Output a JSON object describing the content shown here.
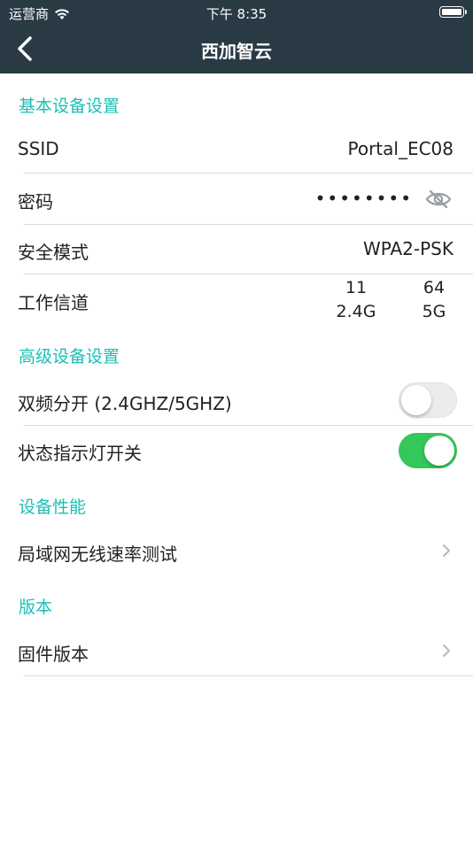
{
  "status_bar": {
    "carrier": "运营商",
    "time": "下午 8:35"
  },
  "nav": {
    "title": "西加智云"
  },
  "sections": {
    "basic": {
      "header": "基本设备设置",
      "ssid_label": "SSID",
      "ssid_value": "Portal_EC08",
      "password_label": "密码",
      "password_mask": "••••••••",
      "security_label": "安全模式",
      "security_value": "WPA2-PSK",
      "channel_label": "工作信道",
      "channel_24_num": "11",
      "channel_24_band": "2.4G",
      "channel_5_num": "64",
      "channel_5_band": "5G"
    },
    "advanced": {
      "header": "高级设备设置",
      "dual_band_label": "双频分开 (2.4GHZ/5GHZ)",
      "dual_band_on": false,
      "led_label": "状态指示灯开关",
      "led_on": true
    },
    "performance": {
      "header": "设备性能",
      "speed_test_label": "局域网无线速率测试"
    },
    "version": {
      "header": "版本",
      "firmware_label": "固件版本"
    }
  },
  "colors": {
    "nav_bg": "#293a45",
    "accent": "#1bbfb4",
    "toggle_on": "#34c759"
  }
}
